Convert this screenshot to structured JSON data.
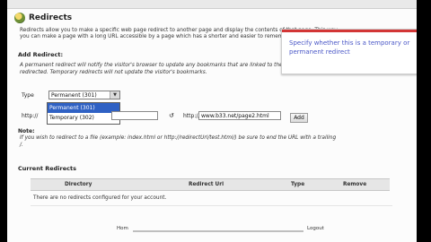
{
  "page": {
    "title": "Redirects",
    "intro_line1": "Redirects allow you to make a specific web page redirect to another page and display the contents of that page. This way",
    "intro_line2": "you can make a page with a long URL accessible by a page which has a shorter and easier to remember URL."
  },
  "add_redirect": {
    "heading": "Add Redirect:",
    "desc_line1": "A permanent redirect will notify the visitor's browser to update any bookmarks that are linked to the page that is being",
    "desc_line2": "redirected. Temporary redirects will not update the visitor's bookmarks.",
    "type_label": "Type",
    "type_selected": "Permanent (301)",
    "type_options": [
      "Permanent (301)",
      "Temporary (302)"
    ],
    "http_label": "http://",
    "arrow_glyph": "↺",
    "www_label": "http://",
    "target_url": "www.b33.net/page2.html",
    "add_button": "Add"
  },
  "note": {
    "heading": "Note:",
    "text_line1": "If you wish to redirect to a file (example: index.html or http://redirectUrl/test.html/) be sure to end the URL with a trailing",
    "text_line2": "/."
  },
  "current_redirects": {
    "heading": "Current Redirects",
    "columns": [
      "Directory",
      "Redirect Url",
      "Type",
      "Remove"
    ],
    "empty_message": "There are no redirects configured for your account."
  },
  "footer": {
    "left_text": "Hom",
    "right_text": "Logout"
  },
  "tooltip": {
    "text": "Specify whether this is a temporary or permanent redirect",
    "accent": "#d33636",
    "text_color": "#4a57c7"
  }
}
